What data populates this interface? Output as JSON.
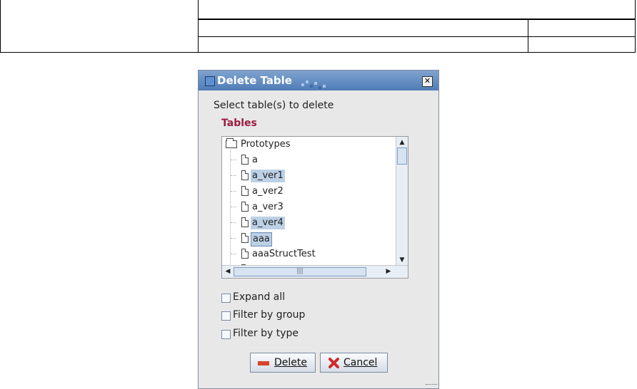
{
  "dialog": {
    "title": "Delete Table",
    "prompt": "Select table(s) to delete",
    "section_label": "Tables",
    "tree": {
      "root": "Prototypes",
      "items": [
        {
          "label": "a",
          "selected": false
        },
        {
          "label": "a_ver1",
          "selected": true
        },
        {
          "label": "a_ver2",
          "selected": false
        },
        {
          "label": "a_ver3",
          "selected": false
        },
        {
          "label": "a_ver4",
          "selected": true
        },
        {
          "label": "aaa",
          "selected": true,
          "lead": true
        },
        {
          "label": "aaaStructTest",
          "selected": false
        }
      ]
    },
    "checkboxes": [
      {
        "label": "Expand all",
        "checked": false
      },
      {
        "label": "Filter by group",
        "checked": false
      },
      {
        "label": "Filter by type",
        "checked": false
      }
    ],
    "buttons": {
      "delete": "Delete",
      "cancel": "Cancel"
    },
    "colors": {
      "titlebar": "#4f7cb7",
      "section_label": "#9b1d40",
      "selection": "#bcd0e6"
    }
  }
}
